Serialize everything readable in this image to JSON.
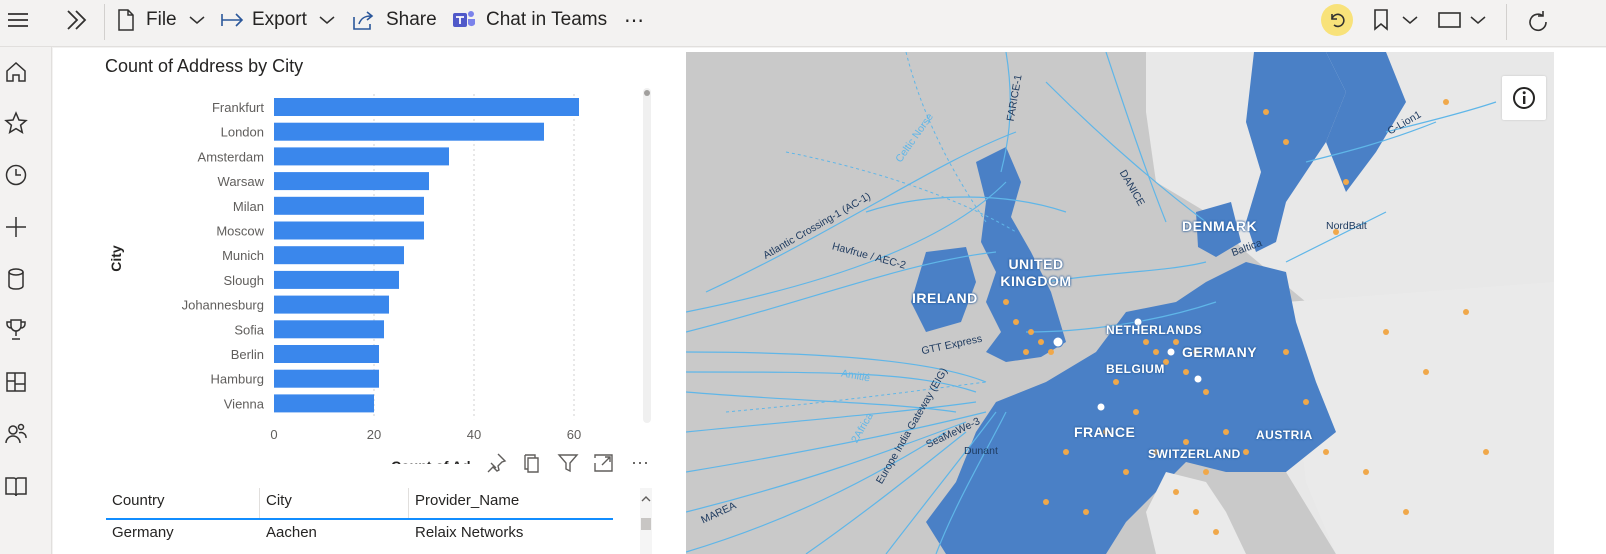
{
  "toolbar": {
    "file_label": "File",
    "export_label": "Export",
    "share_label": "Share",
    "teams_label": "Chat in Teams",
    "more_label": "⋯"
  },
  "sidebar": {
    "items": [
      "hamburger-icon",
      "home-icon",
      "star-icon",
      "clock-icon",
      "plus-icon",
      "database-icon",
      "trophy-icon",
      "workspaces-icon",
      "people-icon",
      "book-icon"
    ]
  },
  "chart_data": {
    "type": "bar",
    "title": "Count of Address by City",
    "ylabel": "City",
    "xlabel": "Count of Address",
    "xlabel_visible": "Count of Ad",
    "categories": [
      "Frankfurt",
      "London",
      "Amsterdam",
      "Warsaw",
      "Milan",
      "Moscow",
      "Munich",
      "Slough",
      "Johannesburg",
      "Sofia",
      "Berlin",
      "Hamburg",
      "Vienna"
    ],
    "values": [
      61,
      54,
      35,
      31,
      30,
      30,
      26,
      25,
      23,
      22,
      21,
      21,
      20
    ],
    "xlim": [
      0,
      70
    ],
    "xticks": [
      0,
      20,
      40,
      60
    ],
    "color": "#3a87ec",
    "grid": true
  },
  "table": {
    "headers": [
      "Country",
      "City",
      "Provider_Name"
    ],
    "rows": [
      [
        "Germany",
        "Aachen",
        "Relaix Networks"
      ]
    ]
  },
  "map": {
    "country_labels": [
      "DENMARK",
      "UNITED KINGDOM",
      "IRELAND",
      "NETHERLANDS",
      "GERMANY",
      "BELGIUM",
      "FRANCE",
      "AUSTRIA",
      "SWITZERLAND"
    ],
    "cable_labels": [
      "FARICE-1",
      "Celtic Norse",
      "DANICE",
      "Atlantic Crossing-1 (AC-1)",
      "Havfrue / AEC-2",
      "GTT Express",
      "Amitié",
      "Europe India Gateway (EIG)",
      "2Africa",
      "SeaMeWe-3",
      "Dunant",
      "MAREA",
      "C-Lion1",
      "NordBalt",
      "Baltica"
    ],
    "colors": {
      "land_highlight": "#4a80c6",
      "land_other": "#e8e8e8",
      "sea": "#c9c9c9",
      "cable": "#5fb6e8",
      "dot": "#f0a84a"
    }
  }
}
